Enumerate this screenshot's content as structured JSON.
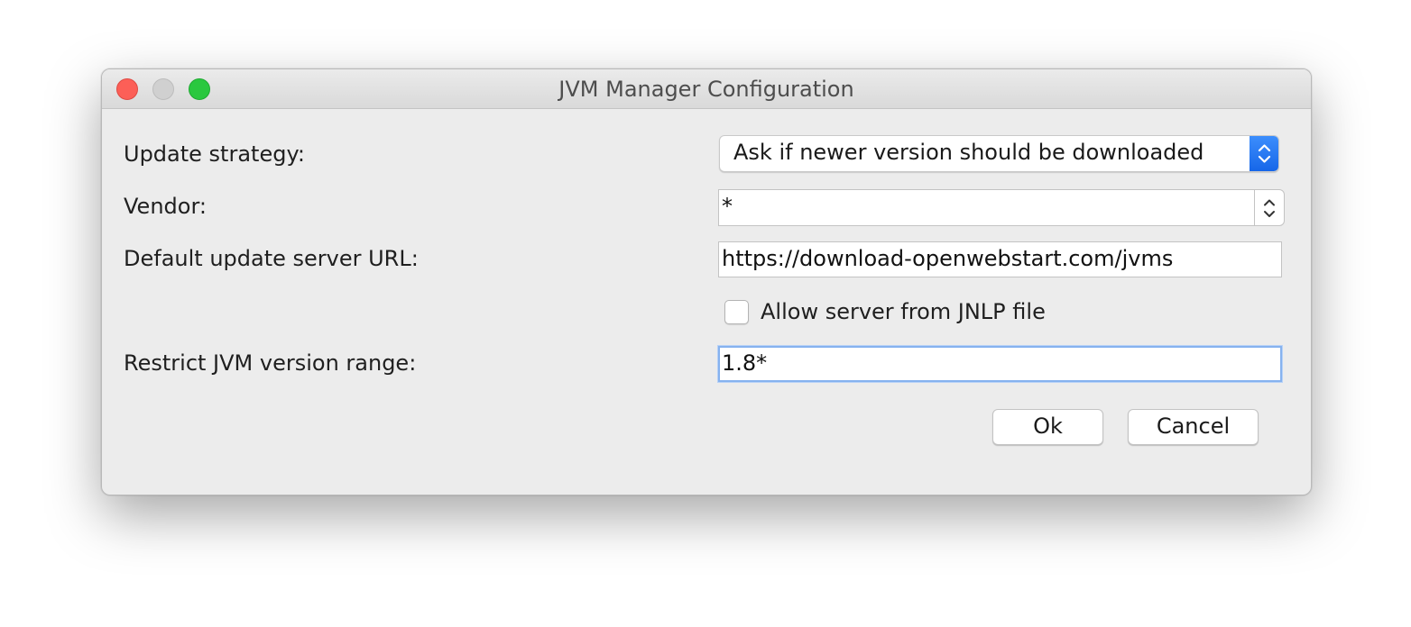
{
  "window": {
    "title": "JVM Manager Configuration"
  },
  "form": {
    "update_strategy": {
      "label": "Update strategy:",
      "selected": "Ask if newer version should be downloaded"
    },
    "vendor": {
      "label": "Vendor:",
      "value": "*"
    },
    "default_update_server_url": {
      "label": "Default update server URL:",
      "value": "https://download-openwebstart.com/jvms"
    },
    "allow_server_from_jnlp": {
      "label": "Allow server from JNLP file",
      "checked": false
    },
    "restrict_jvm_version_range": {
      "label": "Restrict JVM version range:",
      "value": "1.8*"
    }
  },
  "buttons": {
    "ok": "Ok",
    "cancel": "Cancel"
  },
  "colors": {
    "close": "#fc5f57",
    "minimize_inactive": "#d0d0d0",
    "maximize": "#2ac83f",
    "select_accent": "#1f6ff0",
    "focus_ring": "#86b2ef"
  }
}
